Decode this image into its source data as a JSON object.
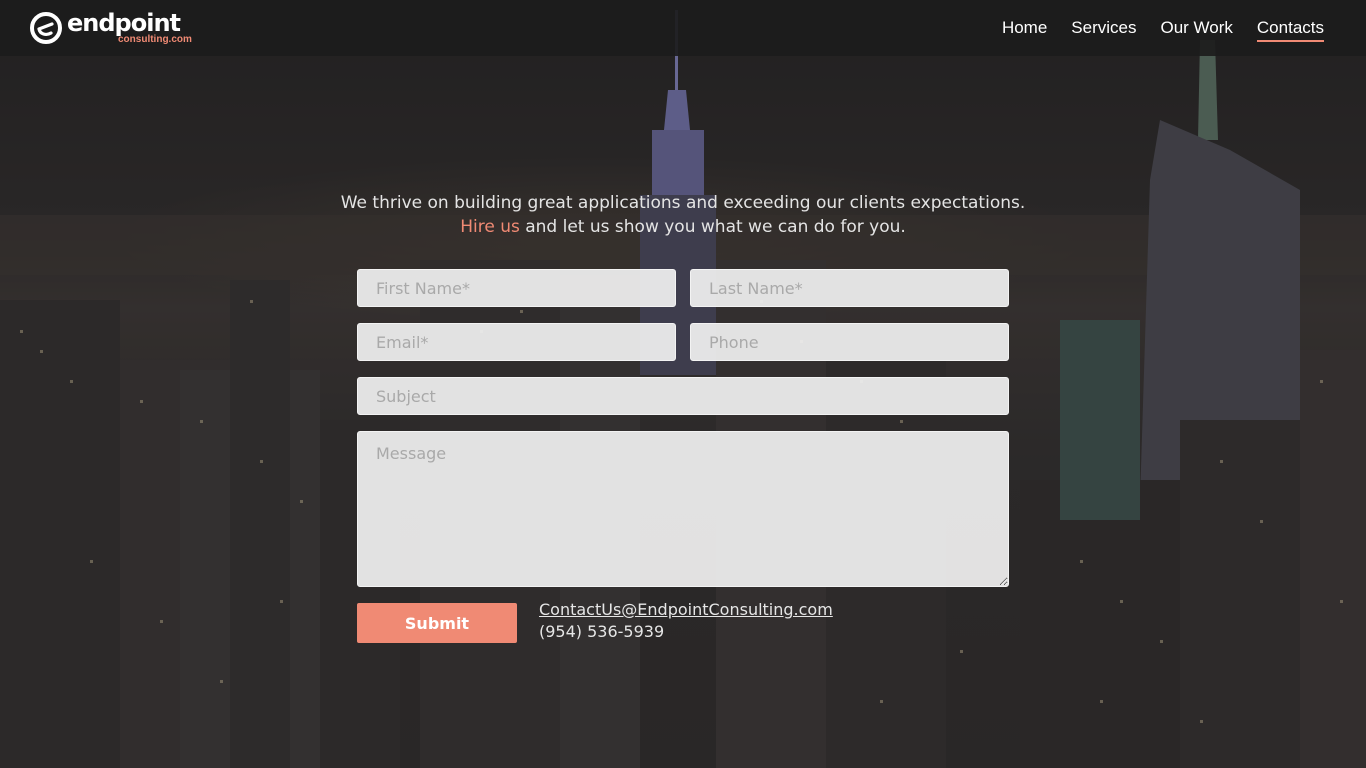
{
  "header": {
    "logo_word": "endpoint",
    "logo_sub": "consulting.com",
    "nav": [
      {
        "label": "Home"
      },
      {
        "label": "Services"
      },
      {
        "label": "Our Work"
      },
      {
        "label": "Contacts"
      }
    ]
  },
  "intro": {
    "line1": "We thrive on building great applications and exceeding our clients expectations.",
    "hire": "Hire us",
    "line2_rest": " and let us show you what we can do for you."
  },
  "form": {
    "first_name": "First Name*",
    "last_name": "Last Name*",
    "email": "Email*",
    "phone": "Phone",
    "subject": "Subject",
    "message": "Message",
    "submit": "Submit"
  },
  "contact": {
    "email": "ContactUs@EndpointConsulting.com",
    "phone": "(954) 536-5939"
  },
  "colors": {
    "accent": "#f08a74",
    "header_bg": "#1c1c1c"
  },
  "icons": {
    "logo": "e-logo-icon"
  }
}
